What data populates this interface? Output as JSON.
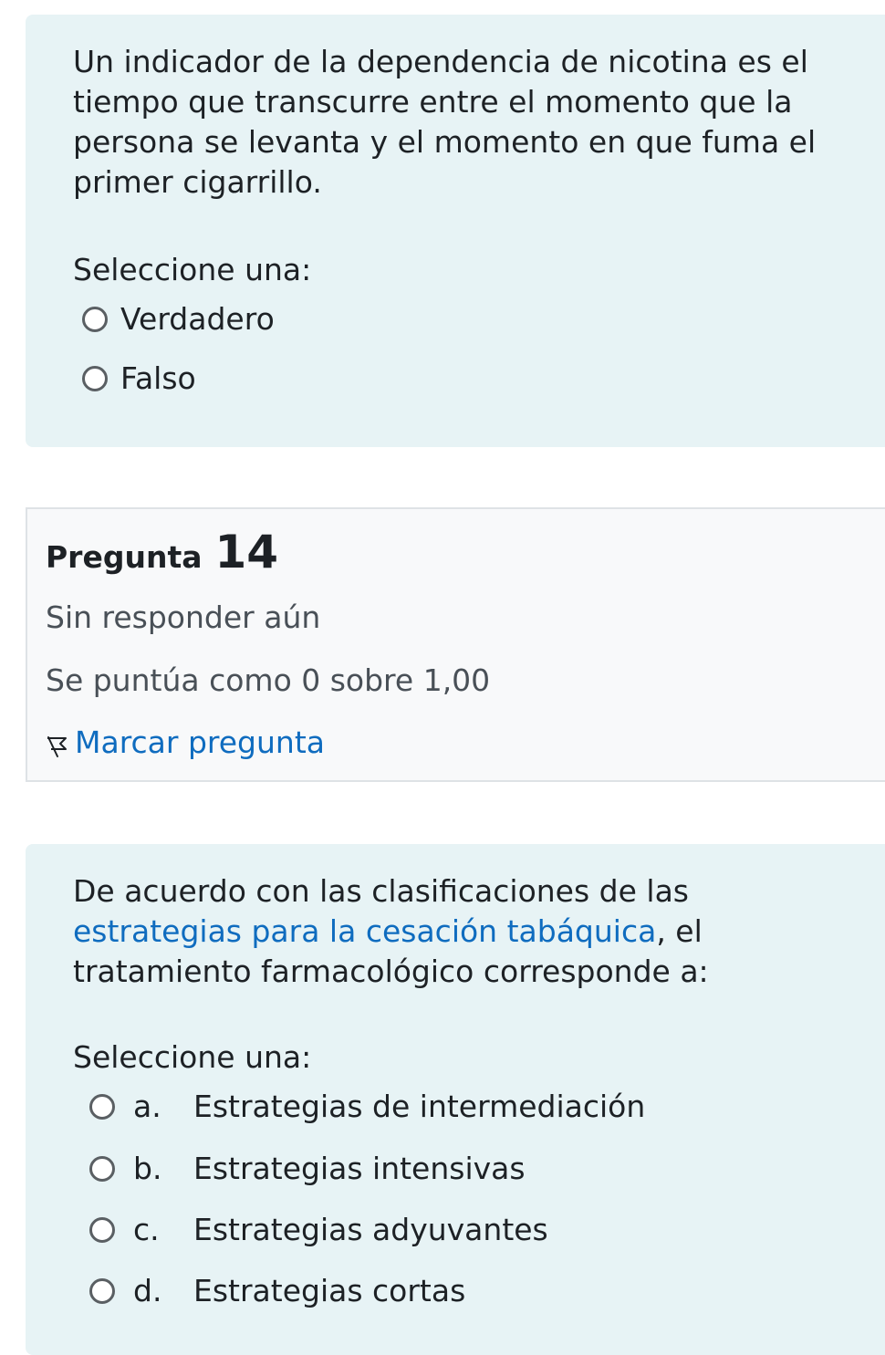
{
  "q13": {
    "text": "Un indicador de la dependencia de nicotina es el tiempo que transcurre entre el momento que la persona se levanta y el momento en que fuma el primer cigarrillo.",
    "prompt": "Seleccione una:",
    "options": [
      {
        "label": "Verdadero"
      },
      {
        "label": "Falso"
      }
    ]
  },
  "q14_info": {
    "label": "Pregunta",
    "number": "14",
    "state": "Sin responder aún",
    "grade": "Se puntúa como 0 sobre 1,00",
    "flag_label": "Marcar pregunta"
  },
  "q14": {
    "text_before": "De acuerdo con las clasificaciones de las ",
    "text_link": "estrategias para la cesación tabáquica",
    "text_after": ", el tratamiento farmacológico corresponde a:",
    "prompt": "Seleccione una:",
    "options": [
      {
        "letter": "a.",
        "label": "Estrategias de intermediación"
      },
      {
        "letter": "b.",
        "label": "Estrategias intensivas"
      },
      {
        "letter": "c.",
        "label": "Estrategias adyuvantes"
      },
      {
        "letter": "d.",
        "label": "Estrategias cortas"
      }
    ]
  },
  "colors": {
    "question_bg": "#e7f3f5",
    "info_bg": "#f8f9fa",
    "link": "#0f6cbf"
  }
}
